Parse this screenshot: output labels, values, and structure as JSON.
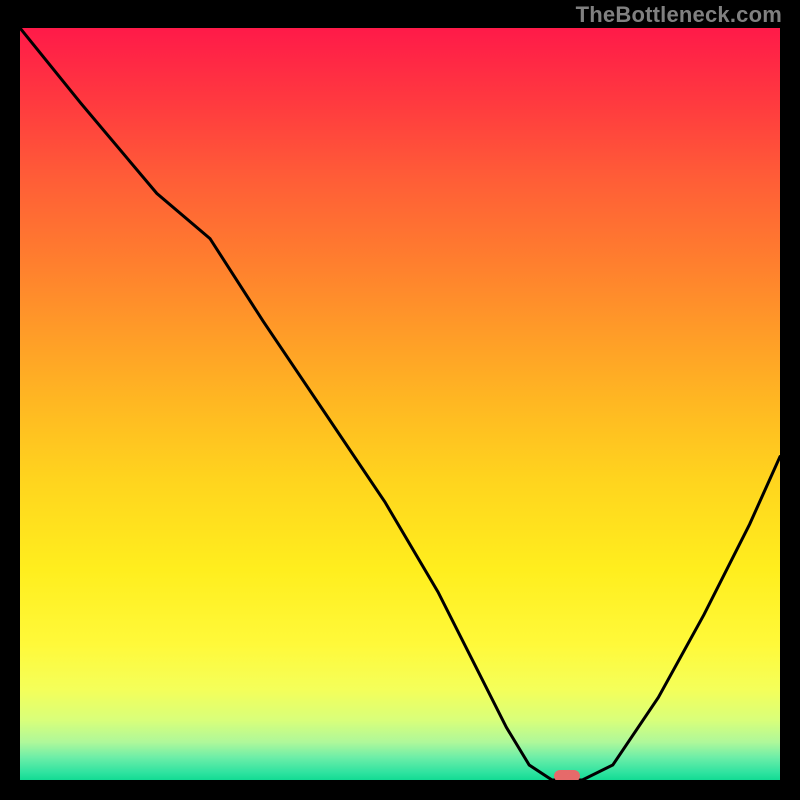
{
  "watermark": "TheBottleneck.com",
  "chart_data": {
    "type": "line",
    "title": "",
    "xlabel": "",
    "ylabel": "",
    "xlim": [
      0,
      100
    ],
    "ylim": [
      0,
      100
    ],
    "grid": false,
    "legend": false,
    "background_gradient": {
      "top": "#ff1a49",
      "bottom": "#12db93",
      "description": "red-to-green vertical gradient (red high, green low)"
    },
    "series": [
      {
        "name": "bottleneck-curve",
        "stroke": "#000000",
        "x": [
          0,
          8,
          18,
          25,
          32,
          40,
          48,
          55,
          60,
          64,
          67,
          70,
          74,
          78,
          84,
          90,
          96,
          100
        ],
        "values": [
          100,
          90,
          78,
          72,
          61,
          49,
          37,
          25,
          15,
          7,
          2,
          0,
          0,
          2,
          11,
          22,
          34,
          43
        ]
      }
    ],
    "marker": {
      "name": "current-config",
      "x": 72,
      "y": 0,
      "color": "#e66a6a",
      "shape": "pill"
    }
  }
}
